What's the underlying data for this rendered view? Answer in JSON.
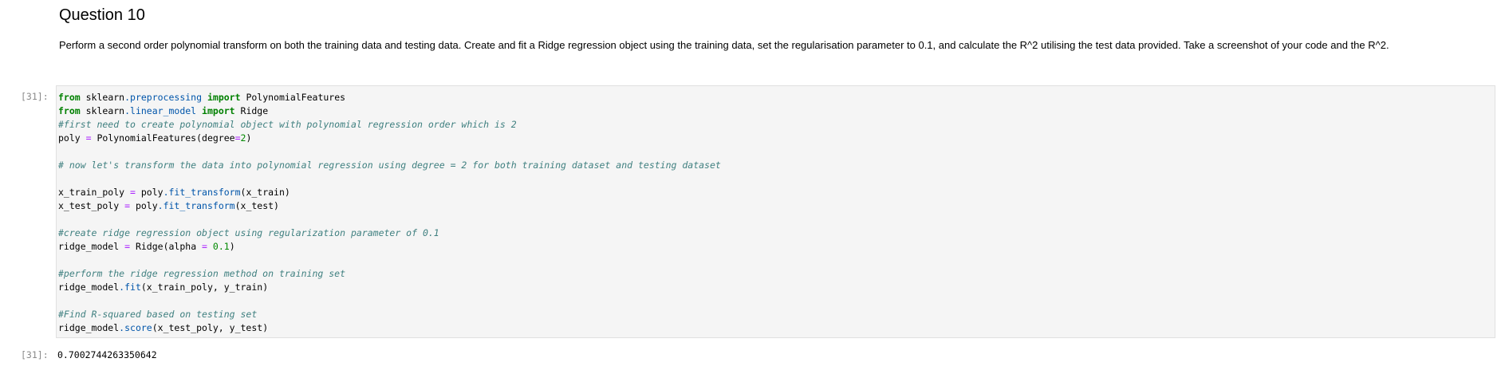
{
  "markdown": {
    "title": "Question 10",
    "paragraph": "Perform a second order polynomial transform on both the training data and testing data. Create and fit a Ridge regression object using the training data, set the regularisation parameter to 0.1, and calculate the R^2 utilising the test data provided. Take a screenshot of your code and the R^2."
  },
  "code_cell": {
    "in_prompt": "[31]:",
    "lines": {
      "l1": {
        "t1": "from",
        "t2": " sklearn",
        "t3": ".preprocessing",
        "t4": " ",
        "t5": "import",
        "t6": " PolynomialFeatures"
      },
      "l2": {
        "t1": "from",
        "t2": " sklearn",
        "t3": ".linear_model",
        "t4": " ",
        "t5": "import",
        "t6": " Ridge"
      },
      "l3": {
        "t1": "#first need to create polynomial object with polynomial regression order which is 2"
      },
      "l4": {
        "t1": "poly ",
        "t2": "=",
        "t3": " PolynomialFeatures(degree",
        "t4": "=",
        "t5": "2",
        "t6": ")"
      },
      "l6": {
        "t1": "# now let's transform the data into polynomial regression using degree = 2 for both training dataset and testing dataset"
      },
      "l8": {
        "t1": "x_train_poly ",
        "t2": "=",
        "t3": " poly",
        "t4": ".fit_transform",
        "t5": "(x_train)"
      },
      "l9": {
        "t1": "x_test_poly ",
        "t2": "=",
        "t3": " poly",
        "t4": ".fit_transform",
        "t5": "(x_test)"
      },
      "l11": {
        "t1": "#create ridge regression object using regularization parameter of 0.1"
      },
      "l12": {
        "t1": "ridge_model ",
        "t2": "=",
        "t3": " Ridge(alpha ",
        "t4": "=",
        "t5": " ",
        "t6": "0.1",
        "t7": ")"
      },
      "l14": {
        "t1": "#perform the ridge regression method on training set"
      },
      "l15": {
        "t1": "ridge_model",
        "t2": ".fit",
        "t3": "(x_train_poly, y_train)"
      },
      "l17": {
        "t1": "#Find R-squared based on testing set"
      },
      "l18": {
        "t1": "ridge_model",
        "t2": ".score",
        "t3": "(x_test_poly, y_test)"
      }
    }
  },
  "output_cell": {
    "out_prompt": "[31]:",
    "value": "0.7002744263350642"
  }
}
